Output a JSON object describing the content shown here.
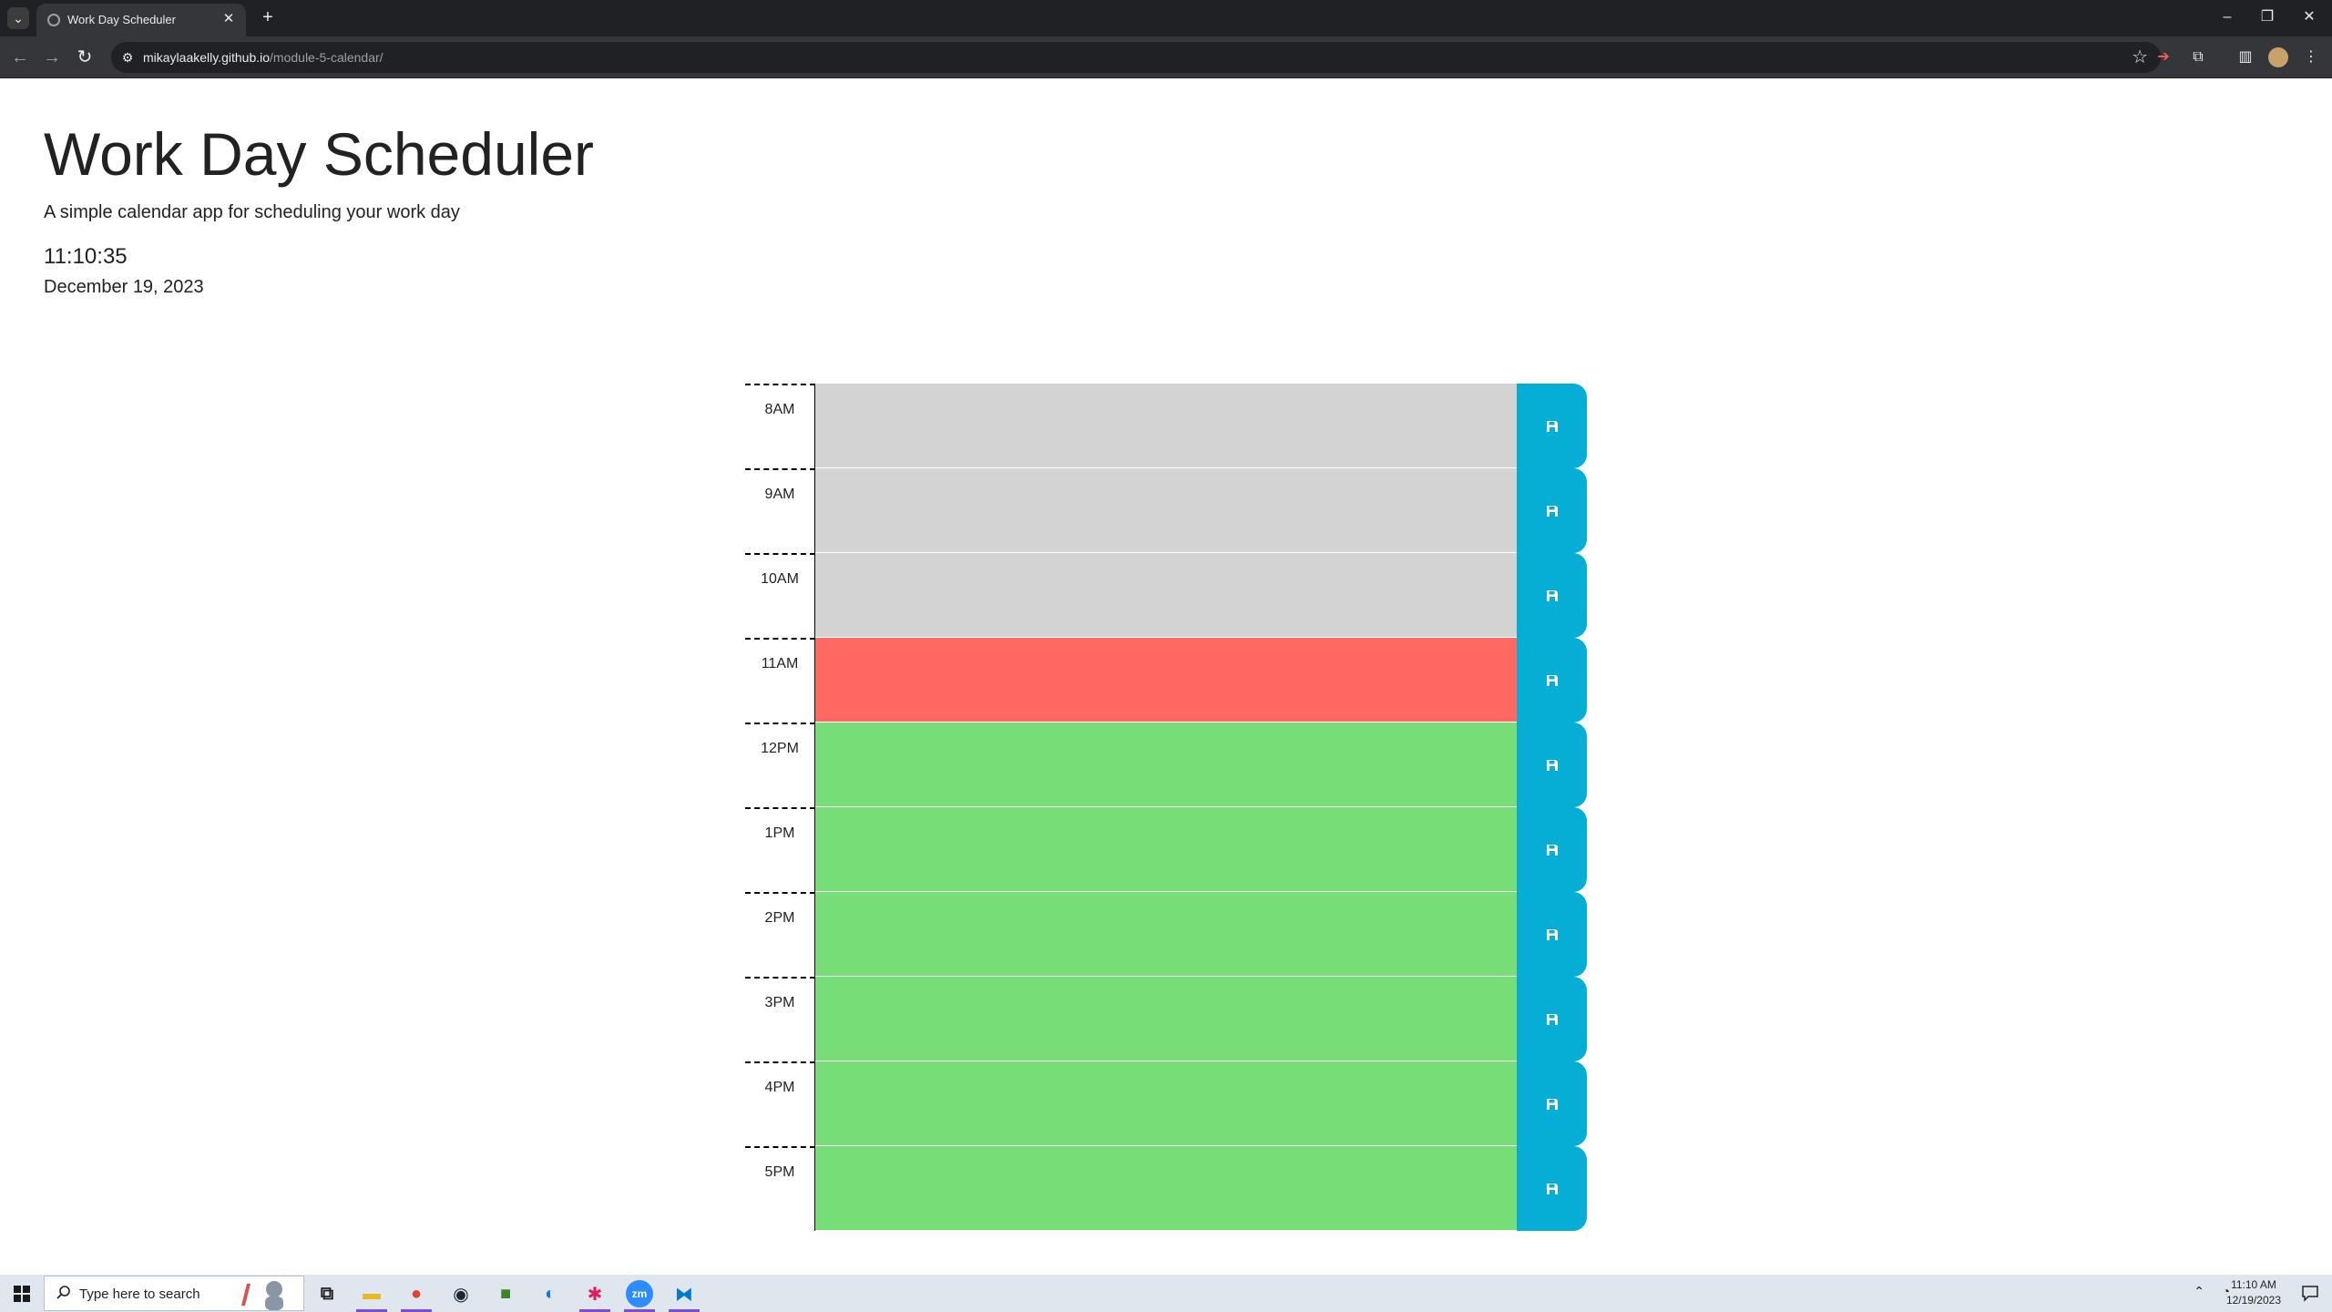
{
  "browser": {
    "tab_list_icon": "chevron-down-icon",
    "tab": {
      "title": "Work Day Scheduler",
      "close": "✕"
    },
    "new_tab": "+",
    "window": {
      "minimize": "–",
      "restore": "❐",
      "close": "✕"
    },
    "url": {
      "host": "mikaylaakelly.github.io",
      "path": "/module-5-calendar/"
    }
  },
  "header": {
    "title": "Work Day Scheduler",
    "lead": "A simple calendar app for scheduling your work day",
    "time": "11:10:35",
    "date": "December 19, 2023"
  },
  "status_colors": {
    "past": "#d3d3d3",
    "present": "#ff6961",
    "future": "#77dd77",
    "save": "#06aed5"
  },
  "hours": [
    {
      "label": "8AM",
      "status": "past",
      "text": ""
    },
    {
      "label": "9AM",
      "status": "past",
      "text": ""
    },
    {
      "label": "10AM",
      "status": "past",
      "text": ""
    },
    {
      "label": "11AM",
      "status": "present",
      "text": ""
    },
    {
      "label": "12PM",
      "status": "future",
      "text": ""
    },
    {
      "label": "1PM",
      "status": "future",
      "text": ""
    },
    {
      "label": "2PM",
      "status": "future",
      "text": ""
    },
    {
      "label": "3PM",
      "status": "future",
      "text": ""
    },
    {
      "label": "4PM",
      "status": "future",
      "text": ""
    },
    {
      "label": "5PM",
      "status": "future",
      "text": ""
    }
  ],
  "taskbar": {
    "search_placeholder": "Type here to search",
    "clock_time": "11:10 AM",
    "clock_date": "12/19/2023",
    "apps": [
      "task-view-icon",
      "file-explorer-icon",
      "chrome-icon",
      "steam-icon",
      "minecraft-icon",
      "edge-icon",
      "slack-icon",
      "zoom-icon",
      "vscode-icon"
    ],
    "zoom_label": "zm"
  }
}
